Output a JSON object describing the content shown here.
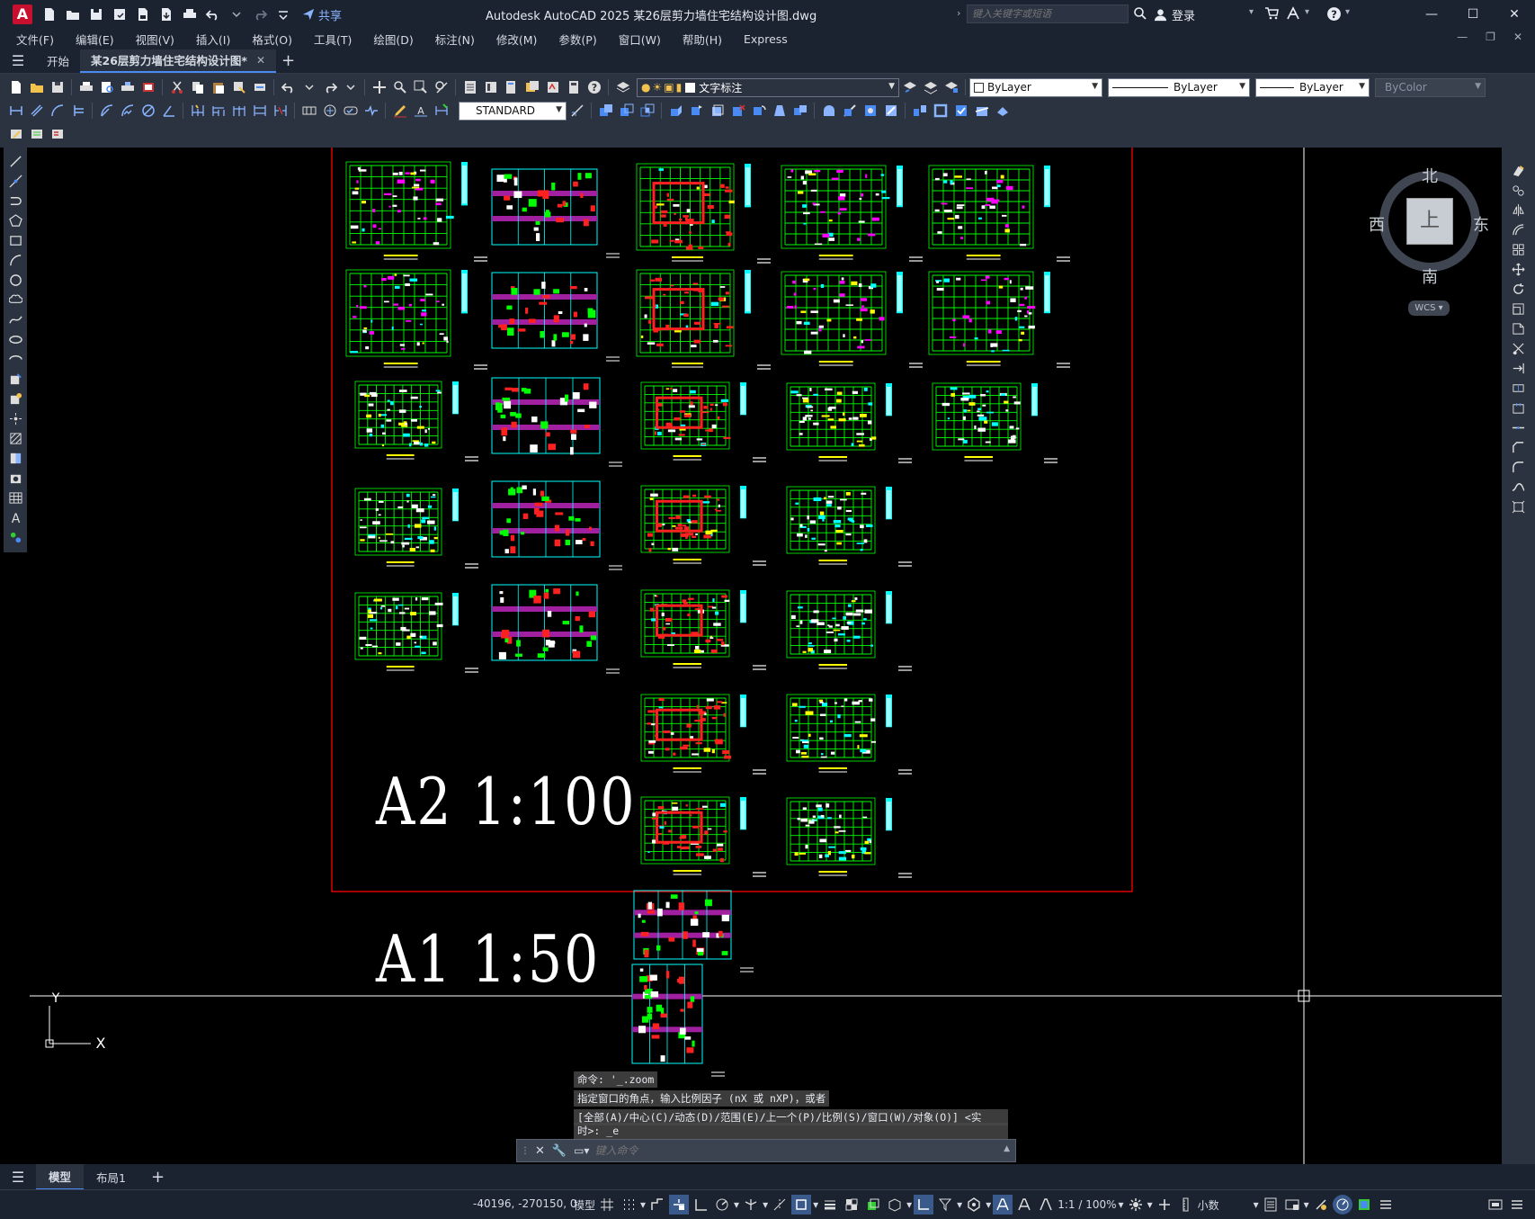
{
  "app": {
    "title": "Autodesk AutoCAD 2025    某26层剪力墙住宅结构设计图.dwg",
    "share_label": "共享",
    "search_placeholder": "键入关键字或短语",
    "login_label": "登录"
  },
  "menu": [
    "文件(F)",
    "编辑(E)",
    "视图(V)",
    "插入(I)",
    "格式(O)",
    "工具(T)",
    "绘图(D)",
    "标注(N)",
    "修改(M)",
    "参数(P)",
    "窗口(W)",
    "帮助(H)",
    "Express"
  ],
  "tabs": {
    "start": "开始",
    "active": "某26层剪力墙住宅结构设计图*"
  },
  "toolbar": {
    "layer_name": "文字标注",
    "color": "ByLayer",
    "linetype": "ByLayer",
    "lineweight": "ByLayer",
    "plotstyle": "ByColor",
    "dimstyle": "STANDARD"
  },
  "viewcube": {
    "north": "北",
    "south": "南",
    "east": "东",
    "west": "西",
    "face": "上",
    "wcs": "WCS"
  },
  "drawing": {
    "label_a2": "A2    1:100",
    "label_a1": "A1    1:50"
  },
  "command": {
    "history": [
      "命令: '_.zoom",
      "指定窗口的角点，输入比例因子 (nX 或 nXP)，或者",
      "[全部(A)/中心(C)/动态(D)/范围(E)/上一个(P)/比例(S)/窗口(W)/对象(O)] <实",
      "时>: _e"
    ],
    "placeholder": "键入命令"
  },
  "layout_tabs": [
    "模型",
    "布局1"
  ],
  "status": {
    "coords": "-40196, -270150, 0",
    "model": "模型",
    "scale": "1:1 / 100%",
    "units": "小数"
  },
  "ucs": {
    "x": "X",
    "y": "Y"
  },
  "colors": {
    "accent": "#4a8af4",
    "border_red": "#ff0000",
    "drawing_green": "#00ff00"
  }
}
